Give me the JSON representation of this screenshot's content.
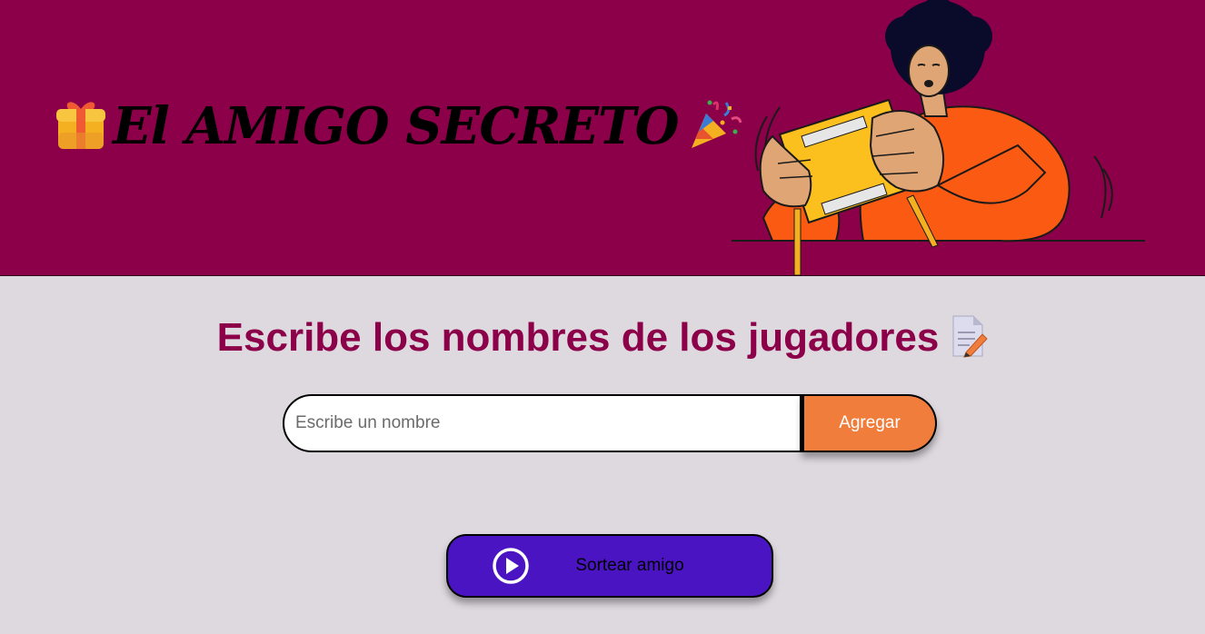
{
  "header": {
    "title": "El AMIGO SECRETO",
    "title_left_icon": "gift-icon",
    "title_right_icon": "party-popper-icon",
    "background_color": "#8b0048",
    "illustration": "person-opening-gift-box-illustration"
  },
  "main": {
    "subtitle": "Escribe los nombres de los jugadores",
    "subtitle_icon": "memo-pencil-icon",
    "subtitle_color": "#8b0048",
    "background_color": "#ded8df",
    "name_input": {
      "value": "",
      "placeholder": "Escribe un nombre"
    },
    "add_button": {
      "label": "Agregar",
      "color": "#f07d3c"
    },
    "draw_button": {
      "label": "Sortear amigo",
      "icon": "play-circle-icon",
      "color": "#4a14c3"
    }
  }
}
